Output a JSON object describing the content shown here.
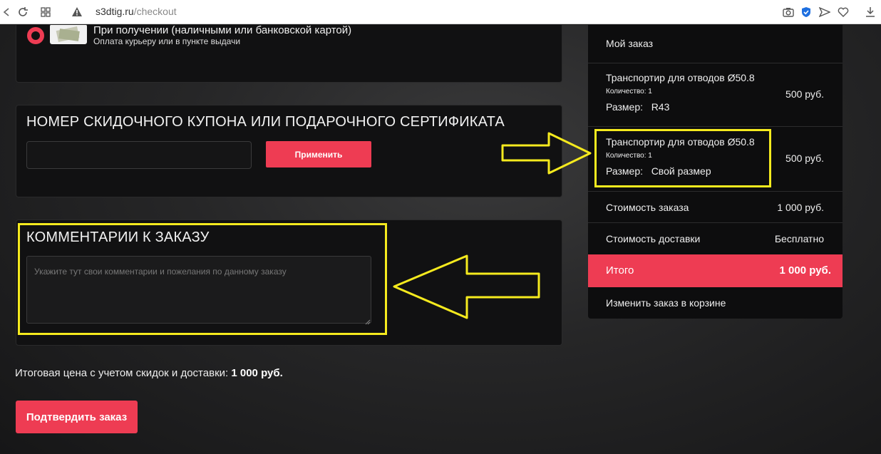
{
  "browser": {
    "url_host": "s3dtig.ru",
    "url_path": "/checkout"
  },
  "payment": {
    "title": "При получении (наличными или банковской картой)",
    "subtitle": "Оплата курьеру или в пункте выдачи"
  },
  "coupon": {
    "title": "НОМЕР СКИДОЧНОГО КУПОНА ИЛИ ПОДАРОЧНОГО СЕРТИФИКАТА",
    "input_value": "",
    "apply_label": "Применить"
  },
  "comments": {
    "title": "КОММЕНТАРИИ К ЗАКАЗУ",
    "placeholder": "Укажите тут свои комментарии и пожелания по данному заказу"
  },
  "final_price": {
    "label": "Итоговая цена с учетом скидок и доставки:",
    "value": "1 000 руб."
  },
  "confirm_label": "Подтвердить заказ",
  "summary": {
    "title": "Мой заказ",
    "items": [
      {
        "name": "Транспортир для отводов Ø50.8",
        "qty": "Количество: 1",
        "size_label": "Размер:",
        "size_value": "R43",
        "price": "500 руб."
      },
      {
        "name": "Транспортир для отводов Ø50.8",
        "qty": "Количество: 1",
        "size_label": "Размер:",
        "size_value": "Свой размер",
        "price": "500 руб."
      }
    ],
    "order_cost_label": "Стоимость заказа",
    "order_cost_value": "1 000 руб.",
    "delivery_label": "Стоимость доставки",
    "delivery_value": "Бесплатно",
    "total_label": "Итого",
    "total_value": "1 000 руб.",
    "edit_link": "Изменить заказ в корзине"
  },
  "colors": {
    "accent": "#ee3c53",
    "highlight": "#f5ea1e"
  }
}
